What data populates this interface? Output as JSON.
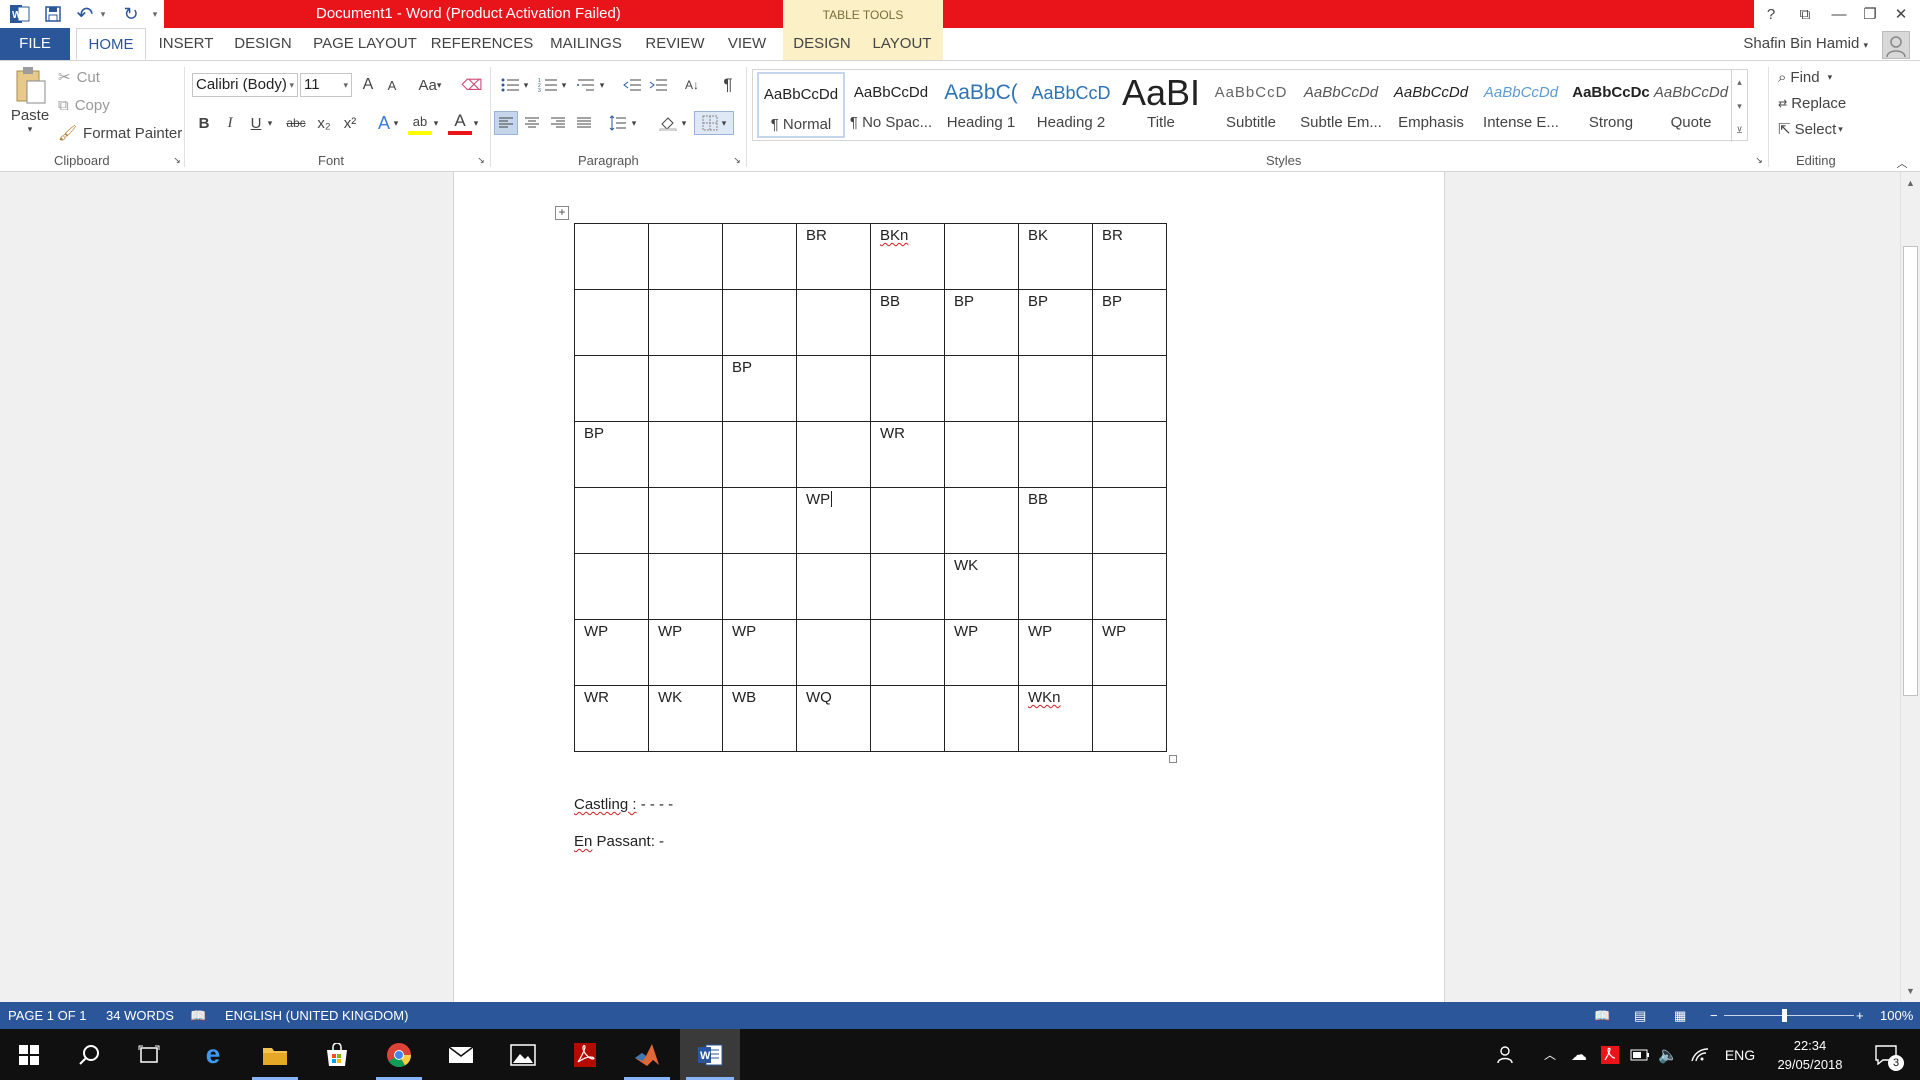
{
  "window": {
    "title": "Document1 - Word (Product Activation Failed)",
    "contextual_group": "TABLE TOOLS",
    "help": "?",
    "restore_ribbon": "⧉",
    "minimize": "—",
    "maximize": "❐",
    "close": "✕"
  },
  "qat": {
    "undo": "↶",
    "redo": "↻",
    "more": "▾"
  },
  "tabs": {
    "file": "FILE",
    "home": "HOME",
    "insert": "INSERT",
    "design": "DESIGN",
    "page_layout": "PAGE LAYOUT",
    "references": "REFERENCES",
    "mailings": "MAILINGS",
    "review": "REVIEW",
    "view": "VIEW",
    "table_design": "DESIGN",
    "table_layout": "LAYOUT"
  },
  "user": {
    "name": "Shafin Bin Hamid"
  },
  "clipboard": {
    "paste": "Paste",
    "cut": "Cut",
    "copy": "Copy",
    "format_painter": "Format Painter",
    "label": "Clipboard"
  },
  "font": {
    "family": "Calibri (Body)",
    "size": "11",
    "label": "Font",
    "grow": "A",
    "shrink": "A",
    "case": "Aa",
    "bold": "B",
    "italic": "I",
    "underline": "U",
    "strike": "abc",
    "sub": "x₂",
    "sup": "x²",
    "effects": "A",
    "highlight": "ab",
    "color": "A"
  },
  "paragraph": {
    "label": "Paragraph",
    "sort": "A↓",
    "pilcrow": "¶"
  },
  "styles": {
    "label": "Styles",
    "items": [
      {
        "preview": "AaBbCcDd",
        "name": "¶ Normal"
      },
      {
        "preview": "AaBbCcDd",
        "name": "¶ No Spac..."
      },
      {
        "preview": "AaBbC(",
        "name": "Heading 1"
      },
      {
        "preview": "AaBbCcD",
        "name": "Heading 2"
      },
      {
        "preview": "AaBI",
        "name": "Title"
      },
      {
        "preview": "AaBbCcD",
        "name": "Subtitle"
      },
      {
        "preview": "AaBbCcDd",
        "name": "Subtle Em..."
      },
      {
        "preview": "AaBbCcDd",
        "name": "Emphasis"
      },
      {
        "preview": "AaBbCcDd",
        "name": "Intense E..."
      },
      {
        "preview": "AaBbCcDc",
        "name": "Strong"
      },
      {
        "preview": "AaBbCcDd",
        "name": "Quote"
      }
    ]
  },
  "editing": {
    "find": "Find",
    "replace": "Replace",
    "select": "Select",
    "label": "Editing"
  },
  "document": {
    "board": [
      [
        "",
        "",
        "",
        "BR",
        "BKn",
        "",
        "BK",
        "BR"
      ],
      [
        "",
        "",
        "",
        "",
        "BB",
        "BP",
        "BP",
        "BP"
      ],
      [
        "",
        "",
        "BP",
        "",
        "",
        "",
        "",
        ""
      ],
      [
        "BP",
        "",
        "",
        "",
        "WR",
        "",
        "",
        ""
      ],
      [
        "",
        "",
        "",
        "WP",
        "",
        "",
        "BB",
        ""
      ],
      [
        "",
        "",
        "",
        "",
        "",
        "WK",
        "",
        ""
      ],
      [
        "WP",
        "WP",
        "WP",
        "",
        "",
        "WP",
        "WP",
        "WP"
      ],
      [
        "WR",
        "WK",
        "WB",
        "WQ",
        "",
        "",
        "WKn",
        ""
      ]
    ],
    "castling_label": "Castling :",
    "castling_value": " - - - -",
    "enpassant_label": "En",
    "enpassant_value": " Passant: -"
  },
  "status": {
    "page": "PAGE 1 OF 1",
    "words": "34 WORDS",
    "language": "ENGLISH (UNITED KINGDOM)",
    "zoom": "100%"
  },
  "taskbar": {
    "language": "ENG",
    "time": "22:34",
    "date": "29/05/2018",
    "notifications": "3"
  },
  "colors": {
    "word_blue": "#2b579a",
    "title_red": "#e8141a",
    "table_tools": "#fbf0c6",
    "taskbar": "#101010",
    "spell_red": "#d12020"
  }
}
